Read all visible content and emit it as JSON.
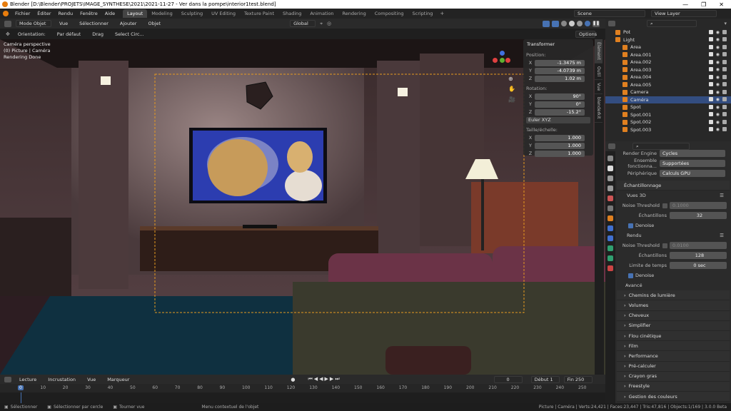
{
  "window": {
    "title": "Blender [D:\\Blender\\PROJETS\\IMAGE_SYNTHESE\\2021\\2021-11-27 - Ver dans la pompe\\interior1test.blend]",
    "controls": [
      "—",
      "❐",
      "✕"
    ]
  },
  "menu": {
    "items": [
      "Fichier",
      "Éditer",
      "Rendu",
      "Fenêtre",
      "Aide"
    ],
    "workspaces": [
      "Layout",
      "Modeling",
      "Sculpting",
      "UV Editing",
      "Texture Paint",
      "Shading",
      "Animation",
      "Rendering",
      "Compositing",
      "Scripting"
    ],
    "scene": "Scene",
    "view_layer": "View Layer"
  },
  "header": {
    "mode": "Mode Objet",
    "menus": [
      "Vue",
      "Sélectionner",
      "Ajouter",
      "Objet"
    ],
    "transform": "Global",
    "options": "Options",
    "orientation_label": "Orientation:",
    "orientation": "Par défaut",
    "drag_label": "Drag",
    "drag": "Select Circ..."
  },
  "viewport": {
    "overlay": [
      "Caméra perspective",
      "(0) Picture | Caméra",
      "Rendering Done"
    ]
  },
  "npanel": {
    "title": "Transformer",
    "position_label": "Position:",
    "position": [
      {
        "axis": "X",
        "value": "-1.3475 m"
      },
      {
        "axis": "Y",
        "value": "-4.0739 m"
      },
      {
        "axis": "Z",
        "value": "1.02 m"
      }
    ],
    "rotation_label": "Rotation:",
    "rotation": [
      {
        "axis": "X",
        "value": "90°"
      },
      {
        "axis": "Y",
        "value": "0°"
      },
      {
        "axis": "Z",
        "value": "-15.2°"
      }
    ],
    "rotation_mode": "Euler XYZ",
    "scale_label": "Taille/échelle:",
    "scale": [
      {
        "axis": "X",
        "value": "1.000"
      },
      {
        "axis": "Y",
        "value": "1.000"
      },
      {
        "axis": "Z",
        "value": "1.000"
      }
    ]
  },
  "ntabs": [
    "Élément",
    "Outil",
    "Vue",
    "blenderkit"
  ],
  "outliner": {
    "rows": [
      {
        "name": "Pot",
        "selected": false
      },
      {
        "name": "Light",
        "selected": false
      },
      {
        "name": "Area",
        "selected": false
      },
      {
        "name": "Area.001",
        "selected": false
      },
      {
        "name": "Area.002",
        "selected": false
      },
      {
        "name": "Area.003",
        "selected": false
      },
      {
        "name": "Area.004",
        "selected": false
      },
      {
        "name": "Area.005",
        "selected": false
      },
      {
        "name": "Camera",
        "selected": false
      },
      {
        "name": "Caméra",
        "selected": true
      },
      {
        "name": "Spot",
        "selected": false
      },
      {
        "name": "Spot.001",
        "selected": false
      },
      {
        "name": "Spot.002",
        "selected": false
      },
      {
        "name": "Spot.003",
        "selected": false
      }
    ]
  },
  "props": {
    "engine_label": "Render Engine",
    "engine": "Cycles",
    "feature_label": "Ensemble fonctionna...",
    "feature": "Supportées",
    "device_label": "Périphérique",
    "device": "Calculs GPU",
    "sampling": "Échantillonnage",
    "viewport_sub": "Vues 3D",
    "noise_label": "Noise Threshold",
    "noise_vp": "0.1000",
    "samples_label": "Échantillons",
    "samples_vp": "32",
    "denoise": "Denoise",
    "render_sub": "Rendu",
    "noise_r": "0.0100",
    "samples_r": "128",
    "time_label": "Limite de temps",
    "time_r": "0 sec",
    "advanced": "Avancé",
    "sections": [
      "Chemins de lumière",
      "Volumes",
      "Cheveux",
      "Simplifier",
      "Flou cinétique",
      "Film",
      "Performance",
      "Pré-calculer",
      "Crayon gras",
      "Freestyle",
      "Gestion des couleurs"
    ]
  },
  "timeline": {
    "menus": [
      "Lecture",
      "Incrustation",
      "Vue",
      "Marqueur"
    ],
    "frame": "0",
    "start_label": "Début",
    "start": "1",
    "end_label": "Fin",
    "end": "250",
    "ticks": [
      "0",
      "10",
      "20",
      "30",
      "40",
      "50",
      "60",
      "70",
      "80",
      "90",
      "100",
      "110",
      "120",
      "130",
      "140",
      "150",
      "160",
      "170",
      "180",
      "190",
      "200",
      "210",
      "220",
      "230",
      "240",
      "250"
    ]
  },
  "status": {
    "select": "Sélectionner",
    "circle": "Sélectionner par cercle",
    "rotate": "Tourner vue",
    "context": "Menu contextuel de l'objet",
    "stats": "Picture | Caméra | Verts:24,421 | Faces:23,447 | Tris:47,816 | Objects:1/169 | 3.0.0 Beta"
  }
}
